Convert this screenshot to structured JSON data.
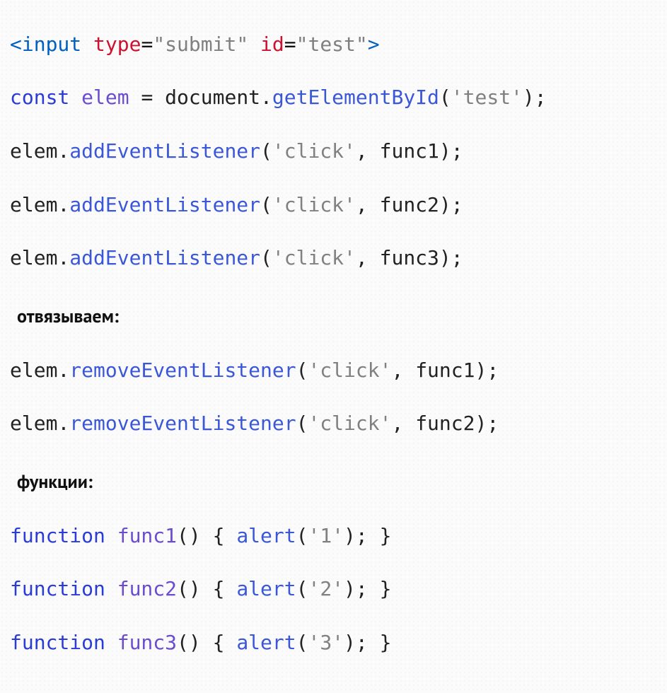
{
  "line1": {
    "open": "<",
    "tag": "input",
    "sp1": " ",
    "attr1": "type",
    "eq1": "=",
    "val1": "\"submit\"",
    "sp2": " ",
    "attr2": "id",
    "eq2": "=",
    "val2": "\"test\"",
    "close": ">"
  },
  "line2": {
    "kw": "const",
    "sp1": " ",
    "var": "elem",
    "sp2": " ",
    "eq": "=",
    "sp3": " ",
    "obj": "document",
    "dot": ".",
    "method": "getElementById",
    "lp": "(",
    "arg": "'test'",
    "rp": ")",
    "semi": ";"
  },
  "add1": {
    "obj": "elem",
    "dot": ".",
    "method": "addEventListener",
    "lp": "(",
    "arg1": "'click'",
    "comma": ", ",
    "arg2": "func1",
    "rp": ")",
    "semi": ";"
  },
  "add2": {
    "obj": "elem",
    "dot": ".",
    "method": "addEventListener",
    "lp": "(",
    "arg1": "'click'",
    "comma": ", ",
    "arg2": "func2",
    "rp": ")",
    "semi": ";"
  },
  "add3": {
    "obj": "elem",
    "dot": ".",
    "method": "addEventListener",
    "lp": "(",
    "arg1": "'click'",
    "comma": ", ",
    "arg2": "func3",
    "rp": ")",
    "semi": ";"
  },
  "comment1": "отвязываем:",
  "rem1": {
    "obj": "elem",
    "dot": ".",
    "method": "removeEventListener",
    "lp": "(",
    "arg1": "'click'",
    "comma": ", ",
    "arg2": "func1",
    "rp": ")",
    "semi": ";"
  },
  "rem2": {
    "obj": "elem",
    "dot": ".",
    "method": "removeEventListener",
    "lp": "(",
    "arg1": "'click'",
    "comma": ", ",
    "arg2": "func2",
    "rp": ")",
    "semi": ";"
  },
  "comment2": "функции:",
  "fn1": {
    "kw": "function",
    "sp": " ",
    "name": "func1",
    "par": "()",
    "sp2": " ",
    "lb": "{",
    "sp3": " ",
    "call": "alert",
    "lp": "(",
    "arg": "'1'",
    "rp": ")",
    "semi": ";",
    "sp4": " ",
    "rb": "}"
  },
  "fn2": {
    "kw": "function",
    "sp": " ",
    "name": "func2",
    "par": "()",
    "sp2": " ",
    "lb": "{",
    "sp3": " ",
    "call": "alert",
    "lp": "(",
    "arg": "'2'",
    "rp": ")",
    "semi": ";",
    "sp4": " ",
    "rb": "}"
  },
  "fn3": {
    "kw": "function",
    "sp": " ",
    "name": "func3",
    "par": "()",
    "sp2": " ",
    "lb": "{",
    "sp3": " ",
    "call": "alert",
    "lp": "(",
    "arg": "'3'",
    "rp": ")",
    "semi": ";",
    "sp4": " ",
    "rb": "}"
  }
}
